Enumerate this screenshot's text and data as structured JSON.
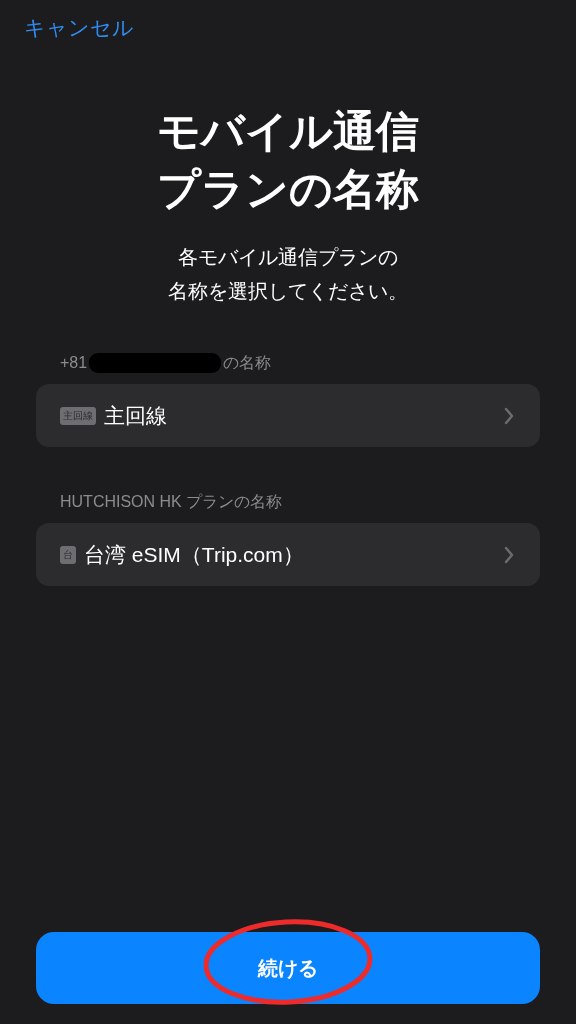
{
  "nav": {
    "cancel": "キャンセル"
  },
  "title_lines": [
    "モバイル通信",
    "プランの名称"
  ],
  "subtitle_lines": [
    "各モバイル通信プランの",
    "名称を選択してください。"
  ],
  "sections": [
    {
      "label": "+81",
      "redacted": true,
      "label_after": "の名称",
      "row": {
        "badge": "主回線",
        "value": "主回線"
      }
    },
    {
      "label": "HUTCHISON HK プランの名称",
      "row": {
        "badge": "台",
        "value": "台湾 eSIM（Trip.com）"
      }
    }
  ],
  "continue_button": {
    "label": "続ける",
    "circled": true
  }
}
